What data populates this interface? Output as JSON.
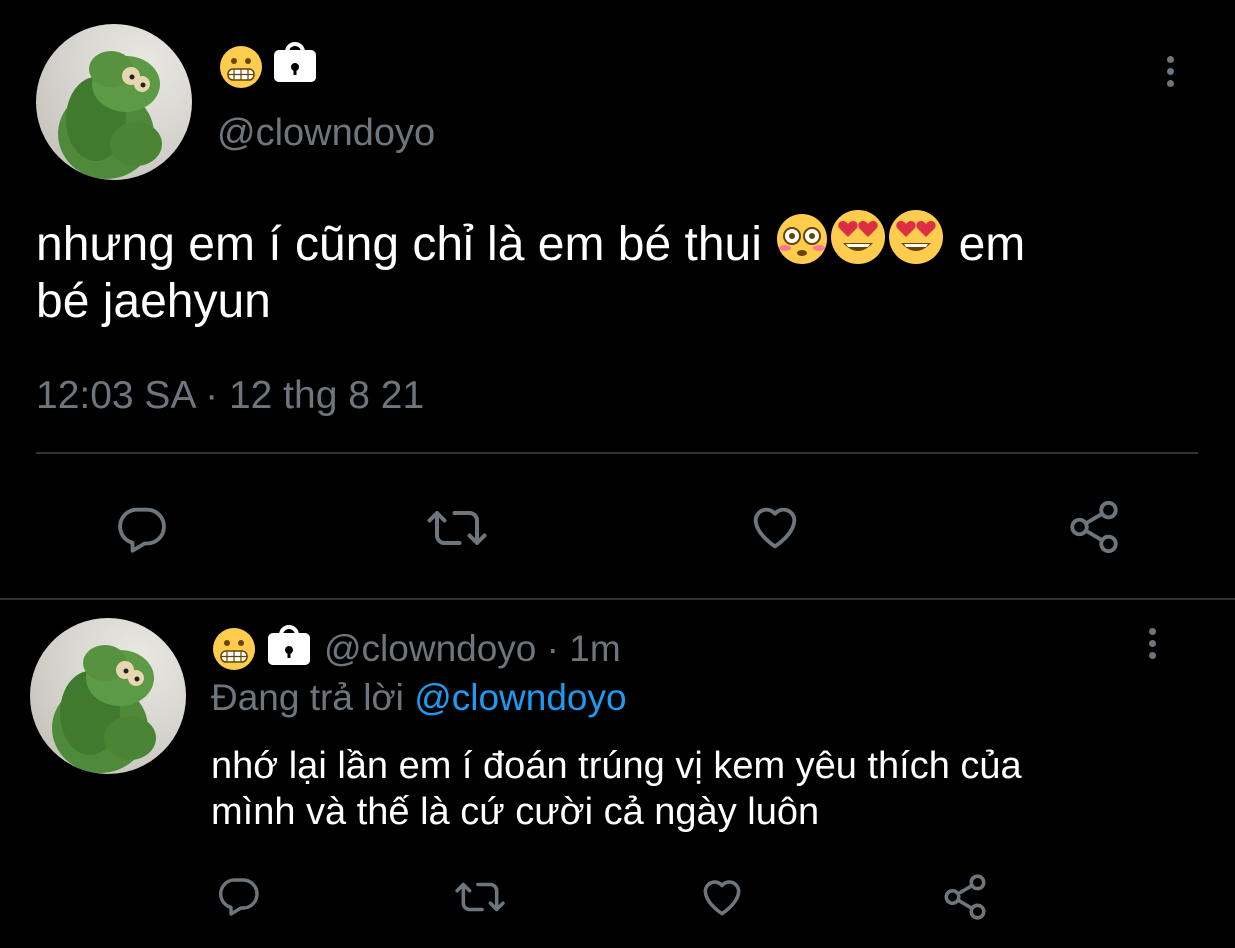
{
  "tweet_main": {
    "display_emoji": "grimacing-face-emoji",
    "lock_icon": "lock-icon",
    "handle": "@clowndoyo",
    "text_line1": "nhưng em í cũng chỉ là em bé thui",
    "text_line1_after": "em",
    "text_line2": "bé jaehyun",
    "emojis": [
      "flushed-face-emoji",
      "heart-eyes-emoji",
      "heart-eyes-emoji"
    ],
    "timestamp": "12:03 SA · 12 thg 8 21",
    "actions": [
      "reply-icon",
      "retweet-icon",
      "like-icon",
      "share-icon"
    ]
  },
  "tweet_reply": {
    "display_emoji": "grimacing-face-emoji",
    "lock_icon": "lock-icon",
    "handle": "@clowndoyo",
    "time": "· 1m",
    "replying_label": "Đang trả lời",
    "replying_to": "@clowndoyo",
    "text_line1": "nhớ lại lần em í đoán trúng vị kem yêu thích của",
    "text_line2": "mình và thế là cứ cười cả ngày luôn",
    "actions": [
      "reply-icon",
      "retweet-icon",
      "like-icon",
      "share-icon"
    ]
  },
  "colors": {
    "background": "#000000",
    "text": "#ffffff",
    "muted": "#6e767d",
    "link": "#1d9bf0",
    "divider": "#2f3336"
  }
}
